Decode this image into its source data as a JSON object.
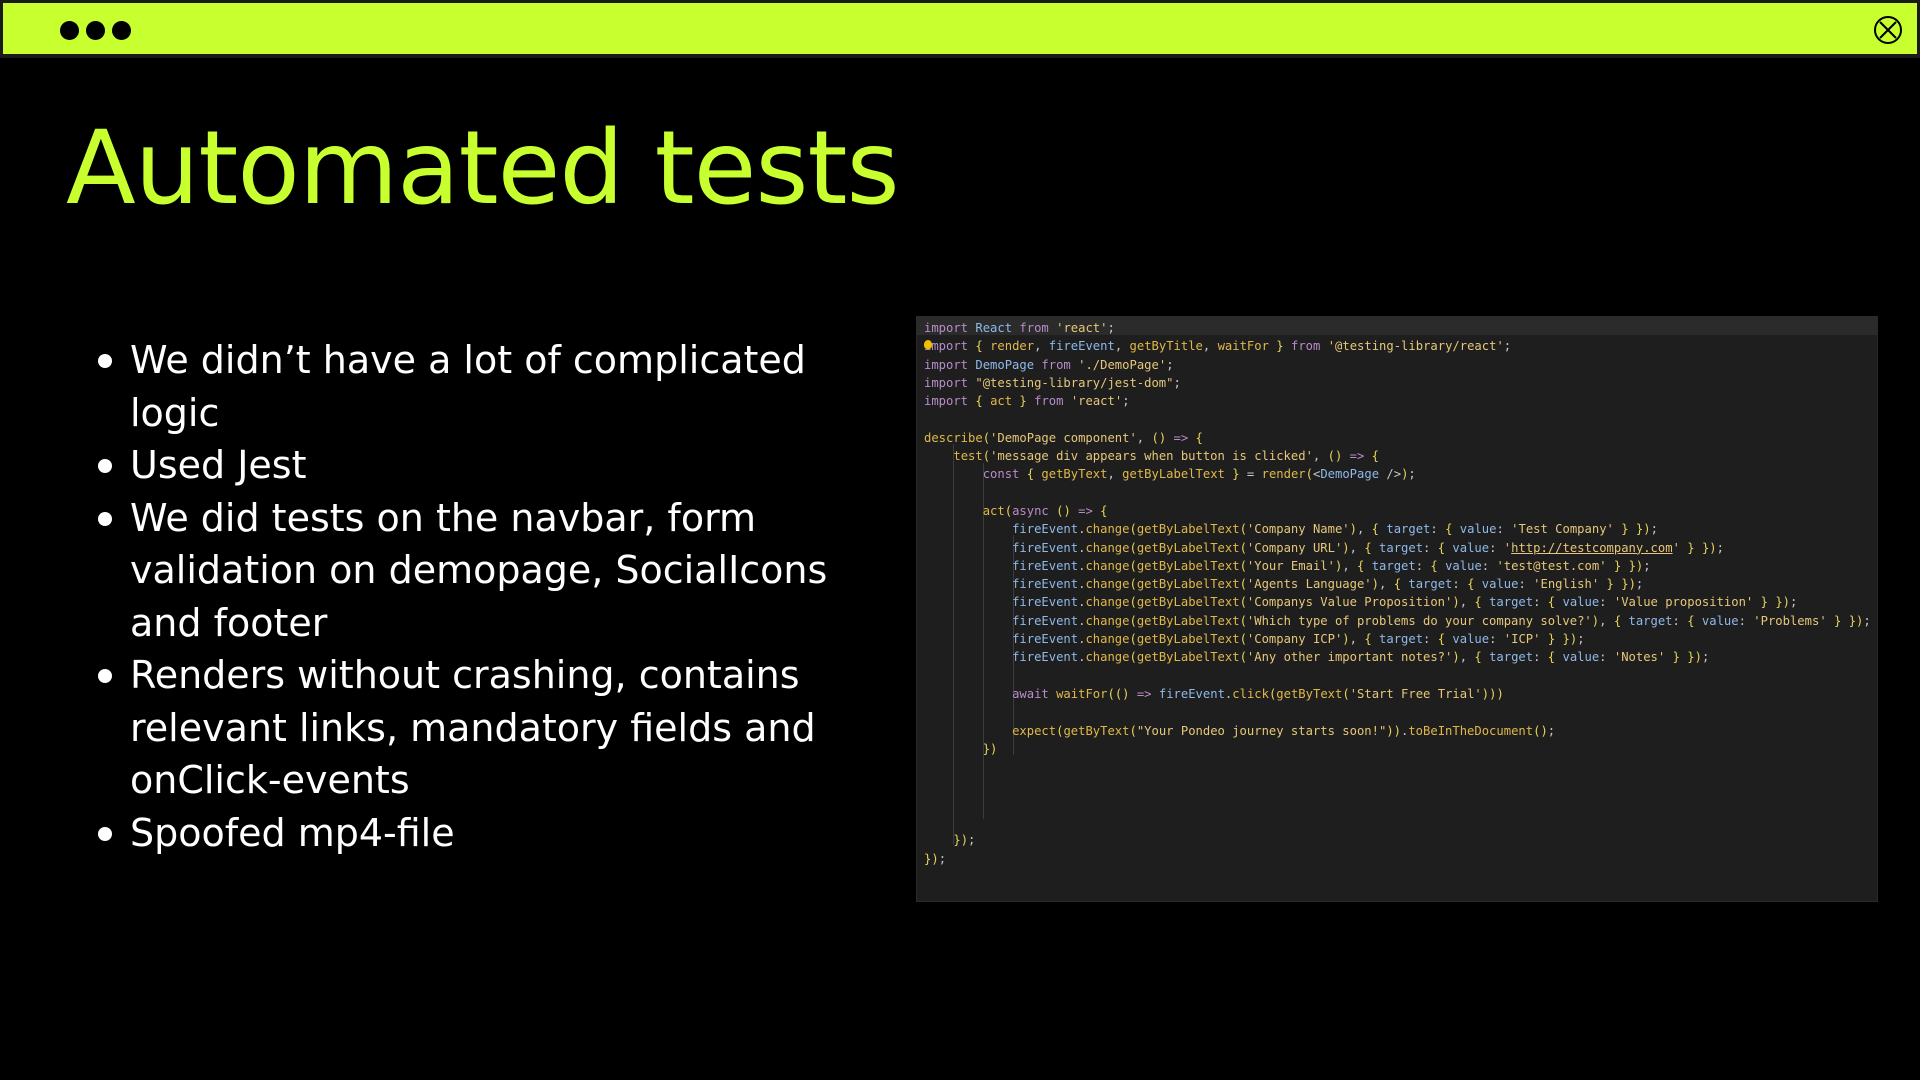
{
  "window": {
    "accent_color": "#c8ff2e",
    "dots_icon": "three-dots-icon",
    "close_icon": "circle-x-icon"
  },
  "slide": {
    "title": "Automated tests",
    "bullets": [
      "We didn’t have a lot of complicated logic",
      "Used Jest",
      "We did tests on the navbar, form validation on demopage, SocialIcons and footer",
      "Renders without crashing, contains relevant links, mandatory fields and onClick-events",
      "Spoofed mp4-file"
    ]
  },
  "code": {
    "lines": [
      "import React from 'react';",
      "import { render, fireEvent, getByTitle, waitFor } from '@testing-library/react';",
      "import DemoPage from './DemoPage';",
      "import \"@testing-library/jest-dom\";",
      "import { act } from 'react';",
      "",
      "describe('DemoPage component', () => {",
      "    test('message div appears when button is clicked', () => {",
      "        const { getByText, getByLabelText } = render(<DemoPage />);",
      "",
      "        act(async () => {",
      "            fireEvent.change(getByLabelText('Company Name'), { target: { value: 'Test Company' } });",
      "            fireEvent.change(getByLabelText('Company URL'), { target: { value: 'http://testcompany.com' } });",
      "            fireEvent.change(getByLabelText('Your Email'), { target: { value: 'test@test.com' } });",
      "            fireEvent.change(getByLabelText('Agents Language'), { target: { value: 'English' } });",
      "            fireEvent.change(getByLabelText('Companys Value Proposition'), { target: { value: 'Value proposition' } });",
      "            fireEvent.change(getByLabelText('Which type of problems do your company solve?'), { target: { value: 'Problems' } });",
      "            fireEvent.change(getByLabelText('Company ICP'), { target: { value: 'ICP' } });",
      "            fireEvent.change(getByLabelText('Any other important notes?'), { target: { value: 'Notes' } });",
      "",
      "            await waitFor(() => fireEvent.click(getByText('Start Free Trial')))",
      "",
      "            expect(getByText(\"Your Pondeo journey starts soon!\")).toBeInTheDocument();",
      "        })",
      "",
      "",
      "",
      "",
      "    });",
      "});"
    ]
  }
}
